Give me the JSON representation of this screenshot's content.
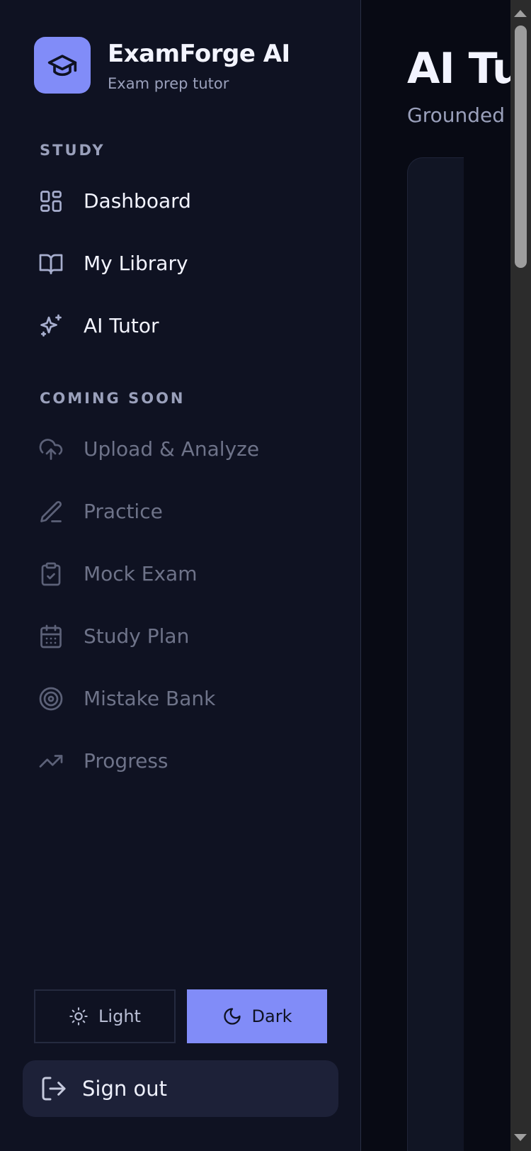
{
  "brand": {
    "name": "ExamForge AI",
    "subtitle": "Exam prep tutor",
    "logo_icon": "graduation-cap-icon",
    "accent_color": "#818cf8"
  },
  "sidebar": {
    "study_heading": "STUDY",
    "study_items": [
      {
        "label": "Dashboard",
        "icon": "grid-icon"
      },
      {
        "label": "My Library",
        "icon": "book-open-icon"
      },
      {
        "label": "AI Tutor",
        "icon": "sparkles-icon"
      }
    ],
    "soon_heading": "COMING SOON",
    "soon_items": [
      {
        "label": "Upload & Analyze",
        "icon": "cloud-upload-icon"
      },
      {
        "label": "Practice",
        "icon": "pencil-icon"
      },
      {
        "label": "Mock Exam",
        "icon": "clipboard-check-icon"
      },
      {
        "label": "Study Plan",
        "icon": "calendar-icon"
      },
      {
        "label": "Mistake Bank",
        "icon": "target-icon"
      },
      {
        "label": "Progress",
        "icon": "trending-up-icon"
      }
    ],
    "theme": {
      "light_label": "Light",
      "dark_label": "Dark",
      "selected": "Dark"
    },
    "signout_label": "Sign out"
  },
  "main": {
    "title": "AI Tu",
    "subtitle": "Grounded i"
  }
}
